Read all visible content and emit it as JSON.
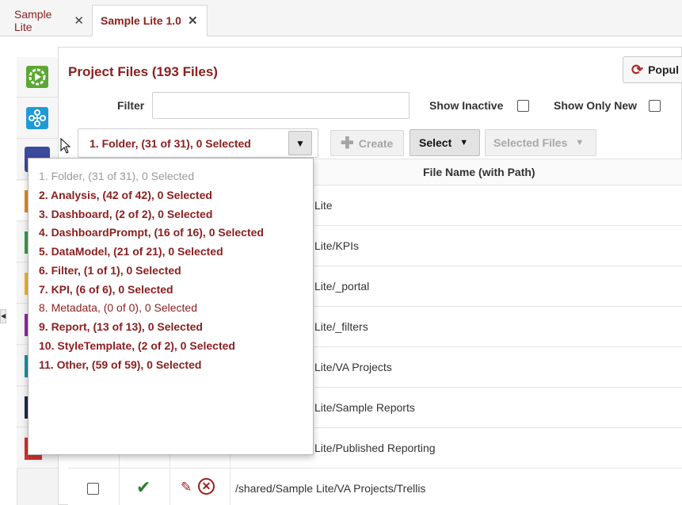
{
  "tabs": [
    {
      "label": "Sample Lite",
      "active": false
    },
    {
      "label": "Sample Lite 1.0",
      "active": true
    }
  ],
  "close_glyph": "✕",
  "sidebar": {
    "items": [
      {
        "icon": "play-gear-icon",
        "color": "#5aa832"
      },
      {
        "icon": "network-node-icon",
        "color": "#1e9bd7"
      },
      {
        "icon": "dashboard-icon",
        "color": "#3a4a9c"
      },
      {
        "icon": "orange-strip-icon",
        "color": "#e58a2b"
      },
      {
        "icon": "green-strip-icon",
        "color": "#3a9c4a"
      },
      {
        "icon": "yellow-strip-icon",
        "color": "#f2b632"
      },
      {
        "icon": "purple-strip-icon",
        "color": "#8e2b9c"
      },
      {
        "icon": "teal-strip-icon",
        "color": "#1d8fa0"
      },
      {
        "icon": "navy-strip-icon",
        "color": "#1d2a4a"
      },
      {
        "icon": "red-strip-icon",
        "color": "#d23232"
      }
    ]
  },
  "header": {
    "title": "Project Files (193 Files)",
    "populate_label": "Popul"
  },
  "filters": {
    "filter_label": "Filter",
    "filter_value": "",
    "show_inactive_label": "Show Inactive",
    "show_only_new_label": "Show Only New"
  },
  "toolbar": {
    "type_select_value": "1. Folder, (31 of 31), 0 Selected",
    "create_label": "Create",
    "select_label": "Select",
    "selected_files_label": "Selected Files"
  },
  "table": {
    "column_file_name": "File Name (with Path)",
    "rows": [
      {
        "path": "Lite"
      },
      {
        "path": "Lite/KPIs"
      },
      {
        "path": "Lite/_portal"
      },
      {
        "path": "Lite/_filters"
      },
      {
        "path": "Lite/VA Projects"
      },
      {
        "path": "Lite/Sample Reports"
      },
      {
        "path": "Lite/Published Reporting"
      },
      {
        "path": "/shared/Sample Lite/VA Projects/Trellis"
      }
    ]
  },
  "dropdown": {
    "options": [
      {
        "label": "1. Folder, (31 of 31), 0 Selected",
        "style": "muted"
      },
      {
        "label": "2. Analysis, (42 of 42), 0 Selected",
        "style": "bold"
      },
      {
        "label": "3. Dashboard, (2 of 2), 0 Selected",
        "style": "bold"
      },
      {
        "label": "4. DashboardPrompt, (16 of 16), 0 Selected",
        "style": "bold"
      },
      {
        "label": "5. DataModel, (21 of 21), 0 Selected",
        "style": "bold"
      },
      {
        "label": "6. Filter, (1 of 1), 0 Selected",
        "style": "bold"
      },
      {
        "label": "7. KPI, (6 of 6), 0 Selected",
        "style": "bold"
      },
      {
        "label": "8. Metadata, (0 of 0), 0 Selected",
        "style": "thin"
      },
      {
        "label": "9. Report, (13 of 13), 0 Selected",
        "style": "bold"
      },
      {
        "label": "10. StyleTemplate, (2 of 2), 0 Selected",
        "style": "bold"
      },
      {
        "label": "11. Other, (59 of 59), 0 Selected",
        "style": "bold"
      }
    ]
  }
}
